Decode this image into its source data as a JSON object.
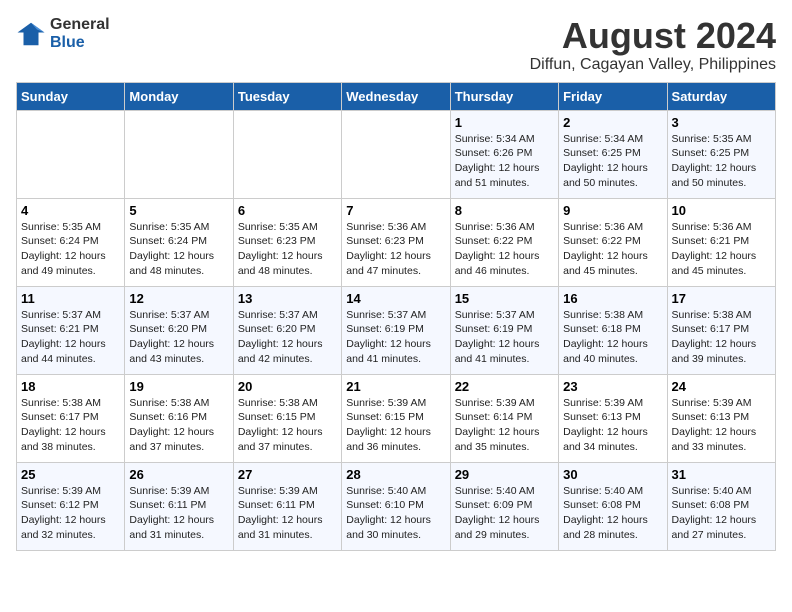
{
  "logo": {
    "line1": "General",
    "line2": "Blue"
  },
  "title": "August 2024",
  "subtitle": "Diffun, Cagayan Valley, Philippines",
  "weekdays": [
    "Sunday",
    "Monday",
    "Tuesday",
    "Wednesday",
    "Thursday",
    "Friday",
    "Saturday"
  ],
  "weeks": [
    [
      {
        "day": "",
        "info": ""
      },
      {
        "day": "",
        "info": ""
      },
      {
        "day": "",
        "info": ""
      },
      {
        "day": "",
        "info": ""
      },
      {
        "day": "1",
        "info": "Sunrise: 5:34 AM\nSunset: 6:26 PM\nDaylight: 12 hours\nand 51 minutes."
      },
      {
        "day": "2",
        "info": "Sunrise: 5:34 AM\nSunset: 6:25 PM\nDaylight: 12 hours\nand 50 minutes."
      },
      {
        "day": "3",
        "info": "Sunrise: 5:35 AM\nSunset: 6:25 PM\nDaylight: 12 hours\nand 50 minutes."
      }
    ],
    [
      {
        "day": "4",
        "info": "Sunrise: 5:35 AM\nSunset: 6:24 PM\nDaylight: 12 hours\nand 49 minutes."
      },
      {
        "day": "5",
        "info": "Sunrise: 5:35 AM\nSunset: 6:24 PM\nDaylight: 12 hours\nand 48 minutes."
      },
      {
        "day": "6",
        "info": "Sunrise: 5:35 AM\nSunset: 6:23 PM\nDaylight: 12 hours\nand 48 minutes."
      },
      {
        "day": "7",
        "info": "Sunrise: 5:36 AM\nSunset: 6:23 PM\nDaylight: 12 hours\nand 47 minutes."
      },
      {
        "day": "8",
        "info": "Sunrise: 5:36 AM\nSunset: 6:22 PM\nDaylight: 12 hours\nand 46 minutes."
      },
      {
        "day": "9",
        "info": "Sunrise: 5:36 AM\nSunset: 6:22 PM\nDaylight: 12 hours\nand 45 minutes."
      },
      {
        "day": "10",
        "info": "Sunrise: 5:36 AM\nSunset: 6:21 PM\nDaylight: 12 hours\nand 45 minutes."
      }
    ],
    [
      {
        "day": "11",
        "info": "Sunrise: 5:37 AM\nSunset: 6:21 PM\nDaylight: 12 hours\nand 44 minutes."
      },
      {
        "day": "12",
        "info": "Sunrise: 5:37 AM\nSunset: 6:20 PM\nDaylight: 12 hours\nand 43 minutes."
      },
      {
        "day": "13",
        "info": "Sunrise: 5:37 AM\nSunset: 6:20 PM\nDaylight: 12 hours\nand 42 minutes."
      },
      {
        "day": "14",
        "info": "Sunrise: 5:37 AM\nSunset: 6:19 PM\nDaylight: 12 hours\nand 41 minutes."
      },
      {
        "day": "15",
        "info": "Sunrise: 5:37 AM\nSunset: 6:19 PM\nDaylight: 12 hours\nand 41 minutes."
      },
      {
        "day": "16",
        "info": "Sunrise: 5:38 AM\nSunset: 6:18 PM\nDaylight: 12 hours\nand 40 minutes."
      },
      {
        "day": "17",
        "info": "Sunrise: 5:38 AM\nSunset: 6:17 PM\nDaylight: 12 hours\nand 39 minutes."
      }
    ],
    [
      {
        "day": "18",
        "info": "Sunrise: 5:38 AM\nSunset: 6:17 PM\nDaylight: 12 hours\nand 38 minutes."
      },
      {
        "day": "19",
        "info": "Sunrise: 5:38 AM\nSunset: 6:16 PM\nDaylight: 12 hours\nand 37 minutes."
      },
      {
        "day": "20",
        "info": "Sunrise: 5:38 AM\nSunset: 6:15 PM\nDaylight: 12 hours\nand 37 minutes."
      },
      {
        "day": "21",
        "info": "Sunrise: 5:39 AM\nSunset: 6:15 PM\nDaylight: 12 hours\nand 36 minutes."
      },
      {
        "day": "22",
        "info": "Sunrise: 5:39 AM\nSunset: 6:14 PM\nDaylight: 12 hours\nand 35 minutes."
      },
      {
        "day": "23",
        "info": "Sunrise: 5:39 AM\nSunset: 6:13 PM\nDaylight: 12 hours\nand 34 minutes."
      },
      {
        "day": "24",
        "info": "Sunrise: 5:39 AM\nSunset: 6:13 PM\nDaylight: 12 hours\nand 33 minutes."
      }
    ],
    [
      {
        "day": "25",
        "info": "Sunrise: 5:39 AM\nSunset: 6:12 PM\nDaylight: 12 hours\nand 32 minutes."
      },
      {
        "day": "26",
        "info": "Sunrise: 5:39 AM\nSunset: 6:11 PM\nDaylight: 12 hours\nand 31 minutes."
      },
      {
        "day": "27",
        "info": "Sunrise: 5:39 AM\nSunset: 6:11 PM\nDaylight: 12 hours\nand 31 minutes."
      },
      {
        "day": "28",
        "info": "Sunrise: 5:40 AM\nSunset: 6:10 PM\nDaylight: 12 hours\nand 30 minutes."
      },
      {
        "day": "29",
        "info": "Sunrise: 5:40 AM\nSunset: 6:09 PM\nDaylight: 12 hours\nand 29 minutes."
      },
      {
        "day": "30",
        "info": "Sunrise: 5:40 AM\nSunset: 6:08 PM\nDaylight: 12 hours\nand 28 minutes."
      },
      {
        "day": "31",
        "info": "Sunrise: 5:40 AM\nSunset: 6:08 PM\nDaylight: 12 hours\nand 27 minutes."
      }
    ]
  ]
}
